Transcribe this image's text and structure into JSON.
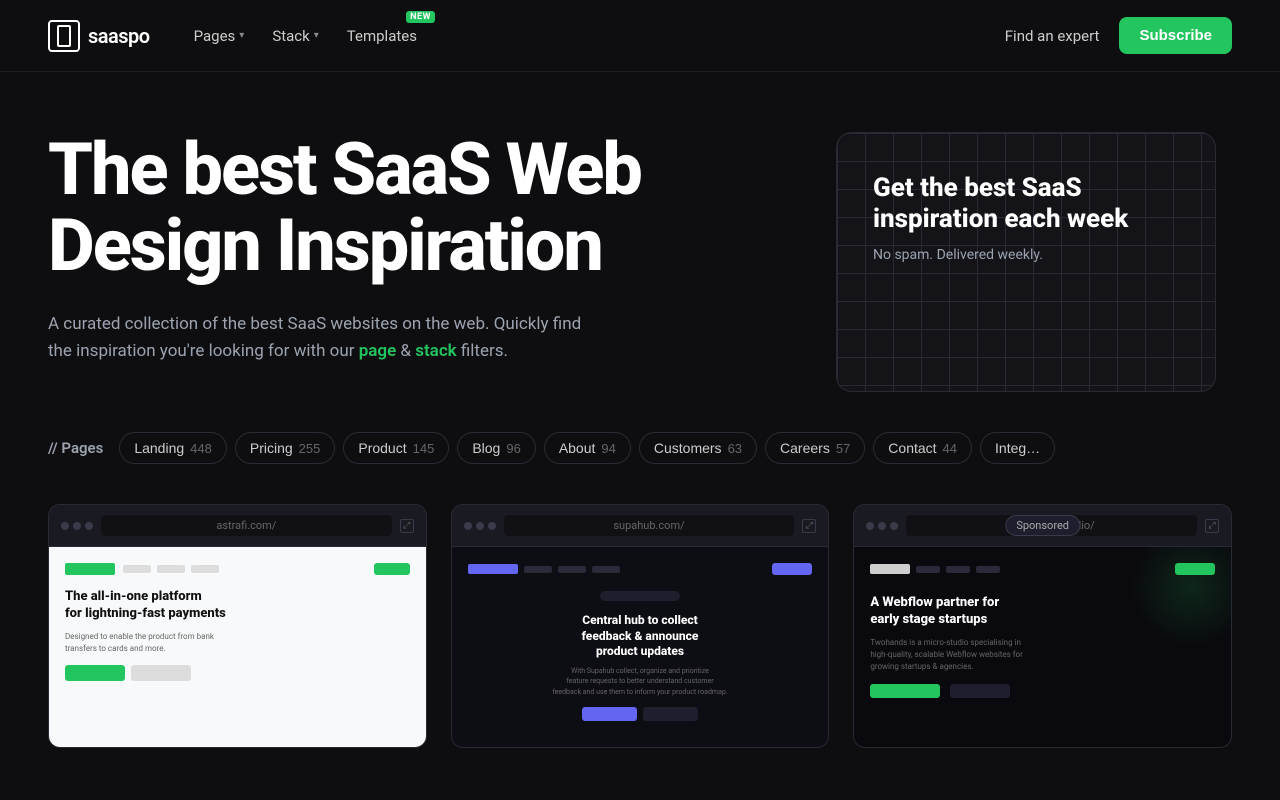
{
  "brand": {
    "name": "saaspo",
    "logo_alt": "saaspo logo"
  },
  "nav": {
    "pages_label": "Pages",
    "stack_label": "Stack",
    "templates_label": "Templates",
    "templates_badge": "NEW",
    "find_expert": "Find an expert",
    "subscribe": "Subscribe"
  },
  "hero": {
    "title": "The best SaaS Web Design Inspiration",
    "subtitle_start": "A curated collection of the best SaaS websites on the web. Quickly find the inspiration you're looking for with our ",
    "subtitle_page": "page",
    "subtitle_and": " & ",
    "subtitle_stack": "stack",
    "subtitle_end": " filters.",
    "signup_title": "Get the best SaaS inspiration each week",
    "signup_subtitle": "No spam. Delivered weekly."
  },
  "pages_section": {
    "label": "// Pages",
    "filters": [
      {
        "name": "Landing",
        "count": "448",
        "active": false
      },
      {
        "name": "Pricing",
        "count": "255",
        "active": false
      },
      {
        "name": "Product",
        "count": "145",
        "active": false
      },
      {
        "name": "Blog",
        "count": "96",
        "active": false
      },
      {
        "name": "About",
        "count": "94",
        "active": false
      },
      {
        "name": "Customers",
        "count": "63",
        "active": false
      },
      {
        "name": "Careers",
        "count": "57",
        "active": false
      },
      {
        "name": "Contact",
        "count": "44",
        "active": false
      },
      {
        "name": "Integ…",
        "count": "",
        "active": false
      }
    ]
  },
  "cards": [
    {
      "url": "astrafi.com/",
      "sponsored": false,
      "theme": "light",
      "headline": "The all-in-one platform for lightning-fast payments",
      "subtitle": "Designed to enable the product from bank transfers to cards and more."
    },
    {
      "url": "supahub.com/",
      "sponsored": false,
      "theme": "dark-purple",
      "headline": "Central hub to collect feedback & announce product updates",
      "subtitle": "With Supahub collect, organize and prioritize feature requests to better understand customer feedback."
    },
    {
      "url": "twohands.studio/",
      "sponsored": true,
      "sponsored_label": "Sponsored",
      "theme": "dark-green",
      "headline": "A Webflow partner for early stage startups",
      "subtitle": "Twohands is a micro-studio specialising in high-quality, scalable Webflow websites for growing startups & agencies."
    }
  ]
}
